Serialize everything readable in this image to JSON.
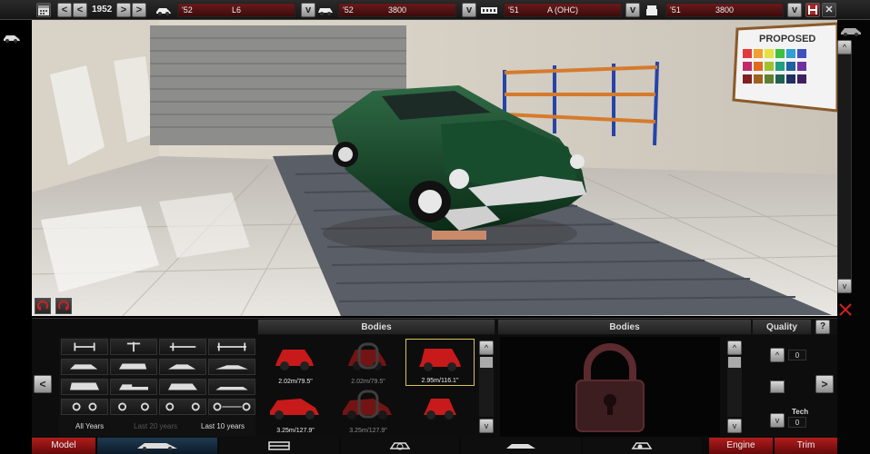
{
  "topbar": {
    "year": "1952",
    "model_engine": {
      "year": "'52",
      "value": "L6"
    },
    "engine_family": {
      "year": "'52",
      "value": "3800"
    },
    "head": {
      "year": "'51",
      "value": "A (OHC)"
    },
    "trim": {
      "year": "'51",
      "value": "3800"
    }
  },
  "scene": {
    "sign_text": "PROPOSED"
  },
  "panel": {
    "bodies_left_title": "Bodies",
    "bodies_right_title": "Bodies",
    "quality_title": "Quality",
    "help_label": "?",
    "filters": {
      "all_years": "All Years",
      "last_20": "Last 20 years",
      "last_10": "Last 10 years"
    },
    "thumbs": [
      {
        "caption": "2.02m/79.5\""
      },
      {
        "caption": "2.02m/79.5\""
      },
      {
        "caption": "2.95m/116.1\""
      },
      {
        "caption": "3.25m/127.9\""
      },
      {
        "caption": "3.25m/127.9\""
      },
      {
        "caption": ""
      }
    ],
    "quality": {
      "top_value": "0",
      "tech_label": "Tech",
      "tech_value": "0"
    }
  },
  "bottomnav": {
    "model": "Model",
    "engine": "Engine",
    "trim": "Trim"
  },
  "colors": {
    "accent_red": "#b11d1d",
    "selection": "#d8c45a",
    "car_green": "#0f3a20"
  }
}
